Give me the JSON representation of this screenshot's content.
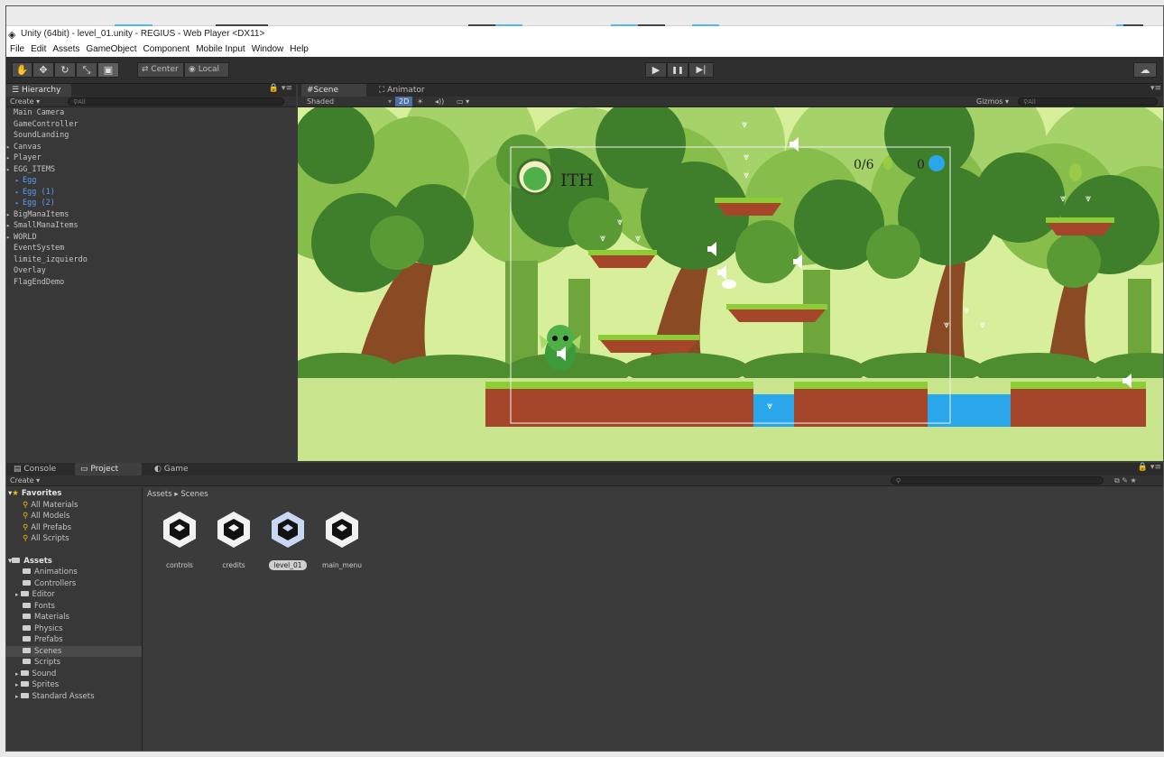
{
  "window": {
    "title": "Unity (64bit) - level_01.unity - REGIUS - Web Player <DX11>"
  },
  "menu": [
    "File",
    "Edit",
    "Assets",
    "GameObject",
    "Component",
    "Mobile Input",
    "Window",
    "Help"
  ],
  "toolbar": {
    "tools": [
      "hand-tool-icon",
      "move-tool-icon",
      "rotate-tool-icon",
      "scale-tool-icon",
      "rect-tool-icon"
    ],
    "pivot_label": "Center",
    "space_label": "Local",
    "play_glyph": "▶",
    "pause_glyph": "❚❚",
    "step_glyph": "▶|"
  },
  "hierarchy": {
    "tab_label": "Hierarchy",
    "create_label": "Create ▾",
    "search_placeholder": "All",
    "items": [
      {
        "label": "Main Camera",
        "indent": 0,
        "arrow": false,
        "blue": false
      },
      {
        "label": "GameController",
        "indent": 0,
        "arrow": false,
        "blue": false
      },
      {
        "label": "SoundLanding",
        "indent": 0,
        "arrow": false,
        "blue": false
      },
      {
        "label": "Canvas",
        "indent": 0,
        "arrow": true,
        "blue": false
      },
      {
        "label": "Player",
        "indent": 0,
        "arrow": true,
        "blue": false
      },
      {
        "label": "EGG_ITEMS",
        "indent": 0,
        "arrow": true,
        "blue": false
      },
      {
        "label": "Egg",
        "indent": 1,
        "arrow": true,
        "blue": true
      },
      {
        "label": "Egg (1)",
        "indent": 1,
        "arrow": true,
        "blue": true
      },
      {
        "label": "Egg (2)",
        "indent": 1,
        "arrow": true,
        "blue": true
      },
      {
        "label": "BigManaItems",
        "indent": 0,
        "arrow": true,
        "blue": false
      },
      {
        "label": "SmallManaItems",
        "indent": 0,
        "arrow": true,
        "blue": false
      },
      {
        "label": "WORLD",
        "indent": 0,
        "arrow": true,
        "blue": false
      },
      {
        "label": "EventSystem",
        "indent": 0,
        "arrow": false,
        "blue": false
      },
      {
        "label": "limite_izquierdo",
        "indent": 0,
        "arrow": false,
        "blue": false
      },
      {
        "label": "Overlay",
        "indent": 0,
        "arrow": false,
        "blue": false
      },
      {
        "label": "FlagEndDemo",
        "indent": 0,
        "arrow": false,
        "blue": false
      }
    ]
  },
  "scene": {
    "tab_scene": "Scene",
    "tab_animator": "Animator",
    "shading": "Shaded",
    "mode_2d": "2D",
    "gizmos": "Gizmos ▾",
    "search_placeholder": "All",
    "hud_title": "ITH",
    "egg_count": "0/6",
    "mana_count": "0",
    "colors": {
      "sky": "#d7ef9b",
      "tree_dark": "#3f7f2c",
      "tree_mid": "#5a9a35",
      "tree_light": "#86bd4b",
      "trunk": "#7a3e1e",
      "grass": "#8ccd36",
      "dirt": "#a5462a",
      "water": "#29a7ea"
    }
  },
  "bottom": {
    "tab_console": "Console",
    "tab_project": "Project",
    "tab_game": "Game",
    "create_label": "Create ▾",
    "breadcrumb": "Assets ▸ Scenes",
    "favorites_label": "Favorites",
    "favorites": [
      "All Materials",
      "All Models",
      "All Prefabs",
      "All Scripts"
    ],
    "assets_label": "Assets",
    "folders": [
      {
        "label": "Animations",
        "arrow": false,
        "selected": false
      },
      {
        "label": "Controllers",
        "arrow": false,
        "selected": false
      },
      {
        "label": "Editor",
        "arrow": true,
        "selected": false
      },
      {
        "label": "Fonts",
        "arrow": false,
        "selected": false
      },
      {
        "label": "Materials",
        "arrow": false,
        "selected": false
      },
      {
        "label": "Physics",
        "arrow": false,
        "selected": false
      },
      {
        "label": "Prefabs",
        "arrow": false,
        "selected": false
      },
      {
        "label": "Scenes",
        "arrow": false,
        "selected": true
      },
      {
        "label": "Scripts",
        "arrow": false,
        "selected": false
      },
      {
        "label": "Sound",
        "arrow": true,
        "selected": false
      },
      {
        "label": "Sprites",
        "arrow": true,
        "selected": false
      },
      {
        "label": "Standard Assets",
        "arrow": true,
        "selected": false
      }
    ],
    "scenes": [
      {
        "label": "controls",
        "selected": false
      },
      {
        "label": "credits",
        "selected": false
      },
      {
        "label": "level_01",
        "selected": true
      },
      {
        "label": "main_menu",
        "selected": false
      }
    ]
  }
}
